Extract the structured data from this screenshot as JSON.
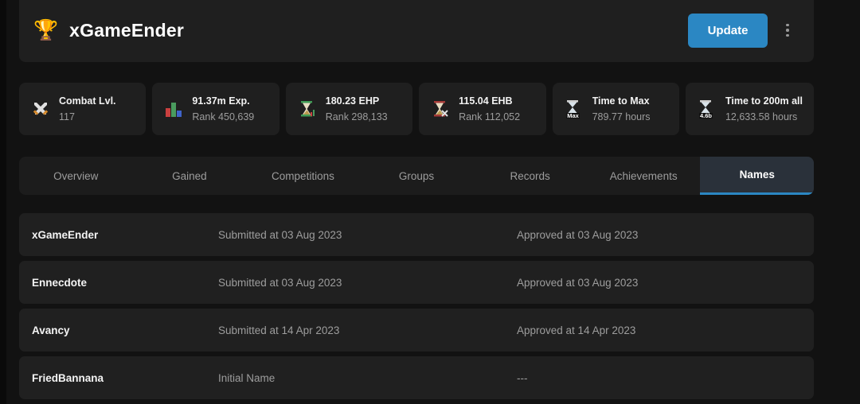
{
  "header": {
    "icon": "trophy-icon",
    "icon_glyph": "🏆",
    "title": "xGameEnder",
    "update_label": "Update",
    "menu_icon": "kebab-menu-icon",
    "accent_color": "#2b87c3"
  },
  "stats": [
    {
      "icon": "crossed-swords-icon",
      "label": "Combat Lvl.",
      "value": "117"
    },
    {
      "icon": "bar-chart-icon",
      "label": "91.37m Exp.",
      "value": "Rank 450,639"
    },
    {
      "icon": "green-hourglass-icon",
      "label": "180.23 EHP",
      "value": "Rank 298,133"
    },
    {
      "icon": "red-hourglass-icon",
      "label": "115.04 EHB",
      "value": "Rank 112,052"
    },
    {
      "icon": "hourglass-max-icon",
      "label": "Time to Max",
      "value": "789.77 hours"
    },
    {
      "icon": "hourglass-200m-icon",
      "label": "Time to 200m all",
      "value": "12,633.58 hours"
    }
  ],
  "tabs": [
    {
      "label": "Overview",
      "active": false
    },
    {
      "label": "Gained",
      "active": false
    },
    {
      "label": "Competitions",
      "active": false
    },
    {
      "label": "Groups",
      "active": false
    },
    {
      "label": "Records",
      "active": false
    },
    {
      "label": "Achievements",
      "active": false
    },
    {
      "label": "Names",
      "active": true
    }
  ],
  "names": [
    {
      "name": "xGameEnder",
      "submitted": "Submitted at 03 Aug 2023",
      "approved": "Approved at 03 Aug 2023"
    },
    {
      "name": "Ennecdote",
      "submitted": "Submitted at 03 Aug 2023",
      "approved": "Approved at 03 Aug 2023"
    },
    {
      "name": "Avancy",
      "submitted": "Submitted at 14 Apr 2023",
      "approved": "Approved at 14 Apr 2023"
    },
    {
      "name": "FriedBannana",
      "submitted": "Initial Name",
      "approved": "---"
    }
  ]
}
